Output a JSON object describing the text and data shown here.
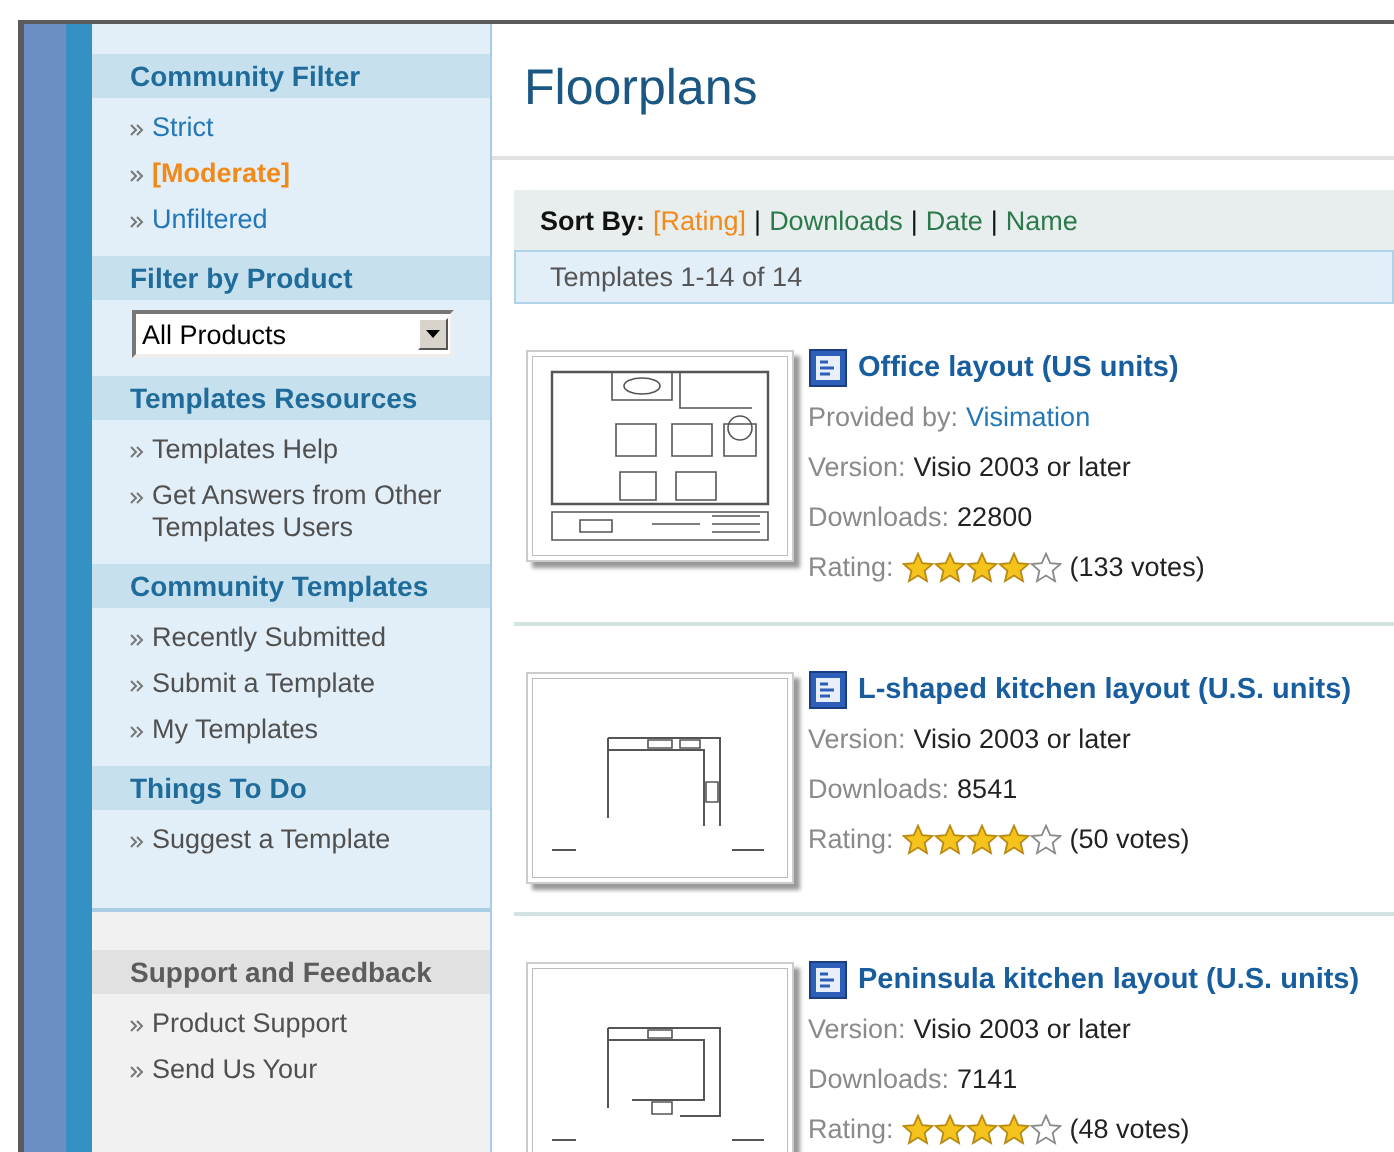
{
  "sidebar": {
    "groups": [
      {
        "kind": "primary",
        "sections": [
          {
            "title": "Community Filter",
            "kind": "links",
            "items": [
              {
                "label": "Strict",
                "selected": false
              },
              {
                "label": "[Moderate]",
                "selected": true
              },
              {
                "label": "Unfiltered",
                "selected": false
              }
            ]
          },
          {
            "title": "Filter by Product",
            "kind": "dropdown",
            "value": "All Products"
          },
          {
            "title": "Templates Resources",
            "kind": "links",
            "items": [
              {
                "label": "Templates Help"
              },
              {
                "label": "Get Answers from Other Templates Users"
              }
            ]
          },
          {
            "title": "Community Templates",
            "kind": "links",
            "items": [
              {
                "label": "Recently Submitted"
              },
              {
                "label": "Submit a Template"
              },
              {
                "label": "My Templates"
              }
            ]
          },
          {
            "title": "Things To Do",
            "kind": "links",
            "items": [
              {
                "label": "Suggest a Template"
              }
            ]
          }
        ]
      },
      {
        "kind": "secondary",
        "sections": [
          {
            "title": "Support and Feedback",
            "kind": "links",
            "items": [
              {
                "label": "Product Support"
              },
              {
                "label": "Send Us Your"
              }
            ]
          }
        ]
      }
    ]
  },
  "page_title": "Floorplans",
  "sort": {
    "label": "Sort By:",
    "separator": "|",
    "options": [
      {
        "label": "[Rating]",
        "selected": true
      },
      {
        "label": "Downloads",
        "selected": false
      },
      {
        "label": "Date",
        "selected": false
      },
      {
        "label": "Name",
        "selected": false
      }
    ]
  },
  "result_count": "Templates 1-14 of 14",
  "items": [
    {
      "title": "Office layout (US units)",
      "kind": "office",
      "provider_label": "Provided by:",
      "provider": "Visimation",
      "version_label": "Version:",
      "version": "Visio 2003 or later",
      "downloads_label": "Downloads:",
      "downloads": "22800",
      "rating_label": "Rating:",
      "stars": 4,
      "votes": "(133 votes)"
    },
    {
      "title": "L-shaped kitchen layout (U.S. units)",
      "kind": "l-kitchen",
      "version_label": "Version:",
      "version": "Visio 2003 or later",
      "downloads_label": "Downloads:",
      "downloads": "8541",
      "rating_label": "Rating:",
      "stars": 4,
      "votes": "(50 votes)"
    },
    {
      "title": "Peninsula kitchen layout (U.S. units)",
      "kind": "peninsula",
      "version_label": "Version:",
      "version": "Visio 2003 or later",
      "downloads_label": "Downloads:",
      "downloads": "7141",
      "rating_label": "Rating:",
      "stars": 4,
      "votes": "(48 votes)"
    }
  ]
}
